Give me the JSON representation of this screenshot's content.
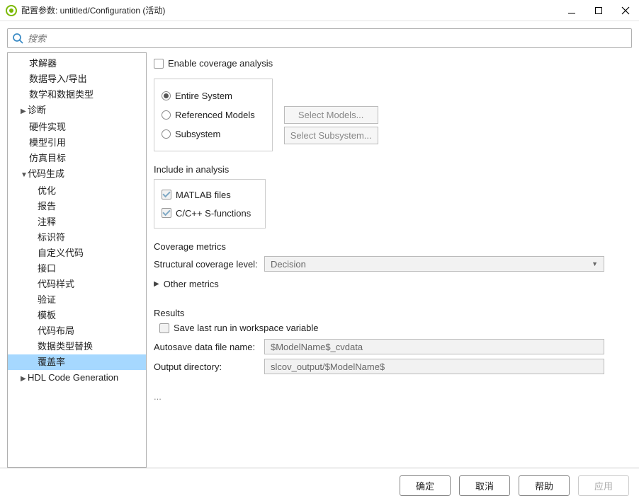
{
  "window": {
    "title": "配置参数: untitled/Configuration (活动)"
  },
  "search": {
    "placeholder": "搜索"
  },
  "nav": {
    "items": [
      {
        "label": "求解器",
        "depth": 1
      },
      {
        "label": "数据导入/导出",
        "depth": 1
      },
      {
        "label": "数学和数据类型",
        "depth": 1
      },
      {
        "label": "诊断",
        "depth": 1,
        "tri": "▶"
      },
      {
        "label": "硬件实现",
        "depth": 1
      },
      {
        "label": "模型引用",
        "depth": 1
      },
      {
        "label": "仿真目标",
        "depth": 1
      },
      {
        "label": "代码生成",
        "depth": 1,
        "tri": "▼"
      },
      {
        "label": "优化",
        "depth": 2
      },
      {
        "label": "报告",
        "depth": 2
      },
      {
        "label": "注释",
        "depth": 2
      },
      {
        "label": "标识符",
        "depth": 2
      },
      {
        "label": "自定义代码",
        "depth": 2
      },
      {
        "label": "接口",
        "depth": 2
      },
      {
        "label": "代码样式",
        "depth": 2
      },
      {
        "label": "验证",
        "depth": 2
      },
      {
        "label": "模板",
        "depth": 2
      },
      {
        "label": "代码布局",
        "depth": 2
      },
      {
        "label": "数据类型替换",
        "depth": 2
      },
      {
        "label": "覆盖率",
        "depth": 2,
        "selected": true
      },
      {
        "label": "HDL Code Generation",
        "depth": 1,
        "tri": "▶"
      }
    ]
  },
  "content": {
    "enable_label": "Enable coverage analysis",
    "scope": {
      "entire": "Entire System",
      "referenced": "Referenced Models",
      "subsystem": "Subsystem",
      "select_models_btn": "Select Models...",
      "select_subsystem_btn": "Select Subsystem..."
    },
    "include_title": "Include in analysis",
    "include": {
      "matlab": "MATLAB files",
      "sfun": "C/C++ S-functions"
    },
    "metrics_title": "Coverage metrics",
    "structural_label": "Structural coverage level:",
    "structural_value": "Decision",
    "other_metrics": "Other metrics",
    "results_title": "Results",
    "save_last_label": "Save last run in workspace variable",
    "autosave_label": "Autosave data file name:",
    "autosave_value": "$ModelName$_cvdata",
    "outdir_label": "Output directory:",
    "outdir_value": "slcov_output/$ModelName$",
    "more": "..."
  },
  "footer": {
    "ok": "确定",
    "cancel": "取消",
    "help": "帮助",
    "apply": "应用"
  }
}
